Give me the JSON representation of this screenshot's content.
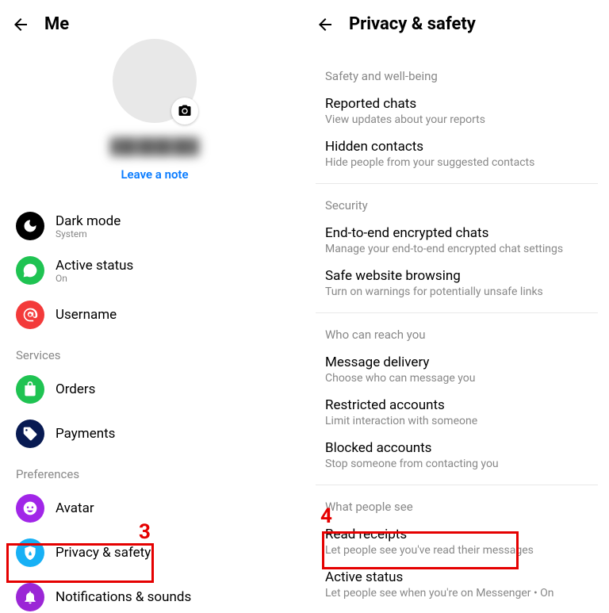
{
  "left": {
    "title": "Me",
    "leave_note": "Leave a note",
    "items": {
      "dark_mode": {
        "label": "Dark mode",
        "sub": "System"
      },
      "active_status": {
        "label": "Active status",
        "sub": "On"
      },
      "username": {
        "label": "Username"
      }
    },
    "sections": {
      "services": "Services",
      "preferences": "Preferences"
    },
    "services": {
      "orders": {
        "label": "Orders"
      },
      "payments": {
        "label": "Payments"
      }
    },
    "preferences": {
      "avatar": {
        "label": "Avatar"
      },
      "privacy_safety": {
        "label": "Privacy & safety"
      },
      "notifications": {
        "label": "Notifications & sounds"
      }
    },
    "annotation": "3"
  },
  "right": {
    "title": "Privacy & safety",
    "sections": {
      "safety": "Safety and well-being",
      "security": "Security",
      "reach": "Who can reach you",
      "see": "What people see"
    },
    "safety": {
      "reported": {
        "label": "Reported chats",
        "sub": "View updates about your reports"
      },
      "hidden": {
        "label": "Hidden contacts",
        "sub": "Hide people from your suggested contacts"
      }
    },
    "security": {
      "e2e": {
        "label": "End-to-end encrypted chats",
        "sub": "Manage your end-to-end encrypted chat settings"
      },
      "safe_browsing": {
        "label": "Safe website browsing",
        "sub": "Turn on warnings for potentially unsafe links"
      }
    },
    "reach": {
      "delivery": {
        "label": "Message delivery",
        "sub": "Choose who can message you"
      },
      "restricted": {
        "label": "Restricted accounts",
        "sub": "Limit interaction with someone"
      },
      "blocked": {
        "label": "Blocked accounts",
        "sub": "Stop someone from contacting you"
      }
    },
    "see": {
      "read_receipts": {
        "label": "Read receipts",
        "sub": "Let people see you've read their messages"
      },
      "active_status": {
        "label": "Active status",
        "sub": "Let people see when you're on Messenger • On"
      }
    },
    "annotation": "4"
  }
}
